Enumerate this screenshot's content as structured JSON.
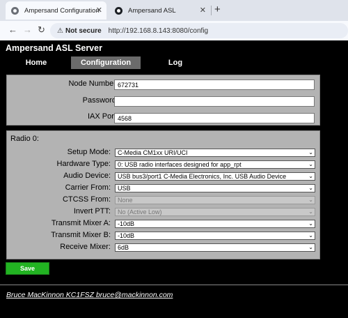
{
  "browser": {
    "tabs": [
      {
        "title": "Ampersand Configuration",
        "icon": "gear-icon",
        "active": true
      },
      {
        "title": "Ampersand ASL",
        "icon": "github-icon",
        "active": false
      }
    ],
    "new_tab": "+",
    "close": "✕",
    "security_label": "Not secure",
    "url": "http://192.168.8.143:8080/config"
  },
  "page": {
    "title": "Ampersand ASL Server",
    "nav": [
      {
        "label": "Home",
        "active": false
      },
      {
        "label": "Configuration",
        "active": true
      },
      {
        "label": "Log",
        "active": false
      }
    ],
    "node": {
      "node_number_label": "Node Number:",
      "node_number": "672731",
      "password_label": "Password:",
      "password": "",
      "iax_port_label": "IAX Port:",
      "iax_port": "4568"
    },
    "radio": {
      "title": "Radio 0:",
      "fields": [
        {
          "label": "Setup Mode:",
          "value": "C-Media CM1xx URI/UCI",
          "disabled": false
        },
        {
          "label": "Hardware Type:",
          "value": "0: USB radio interfaces designed for app_rpt",
          "disabled": false
        },
        {
          "label": "Audio Device:",
          "value": "USB bus3/port1 C-Media Electronics, Inc. USB Audio Device",
          "disabled": false
        },
        {
          "label": "Carrier From:",
          "value": "USB",
          "disabled": false
        },
        {
          "label": "CTCSS From:",
          "value": "None",
          "disabled": true
        },
        {
          "label": "Invert PTT:",
          "value": "No (Active Low)",
          "disabled": true
        },
        {
          "label": "Transmit Mixer A:",
          "value": "-10dB",
          "disabled": false
        },
        {
          "label": "Transmit Mixer B:",
          "value": "-10dB",
          "disabled": false
        },
        {
          "label": "Receive Mixer:",
          "value": "6dB",
          "disabled": false
        }
      ]
    },
    "save_label": "Save",
    "footer": "Bruce MacKinnon KC1FSZ bruce@mackinnon.com"
  }
}
